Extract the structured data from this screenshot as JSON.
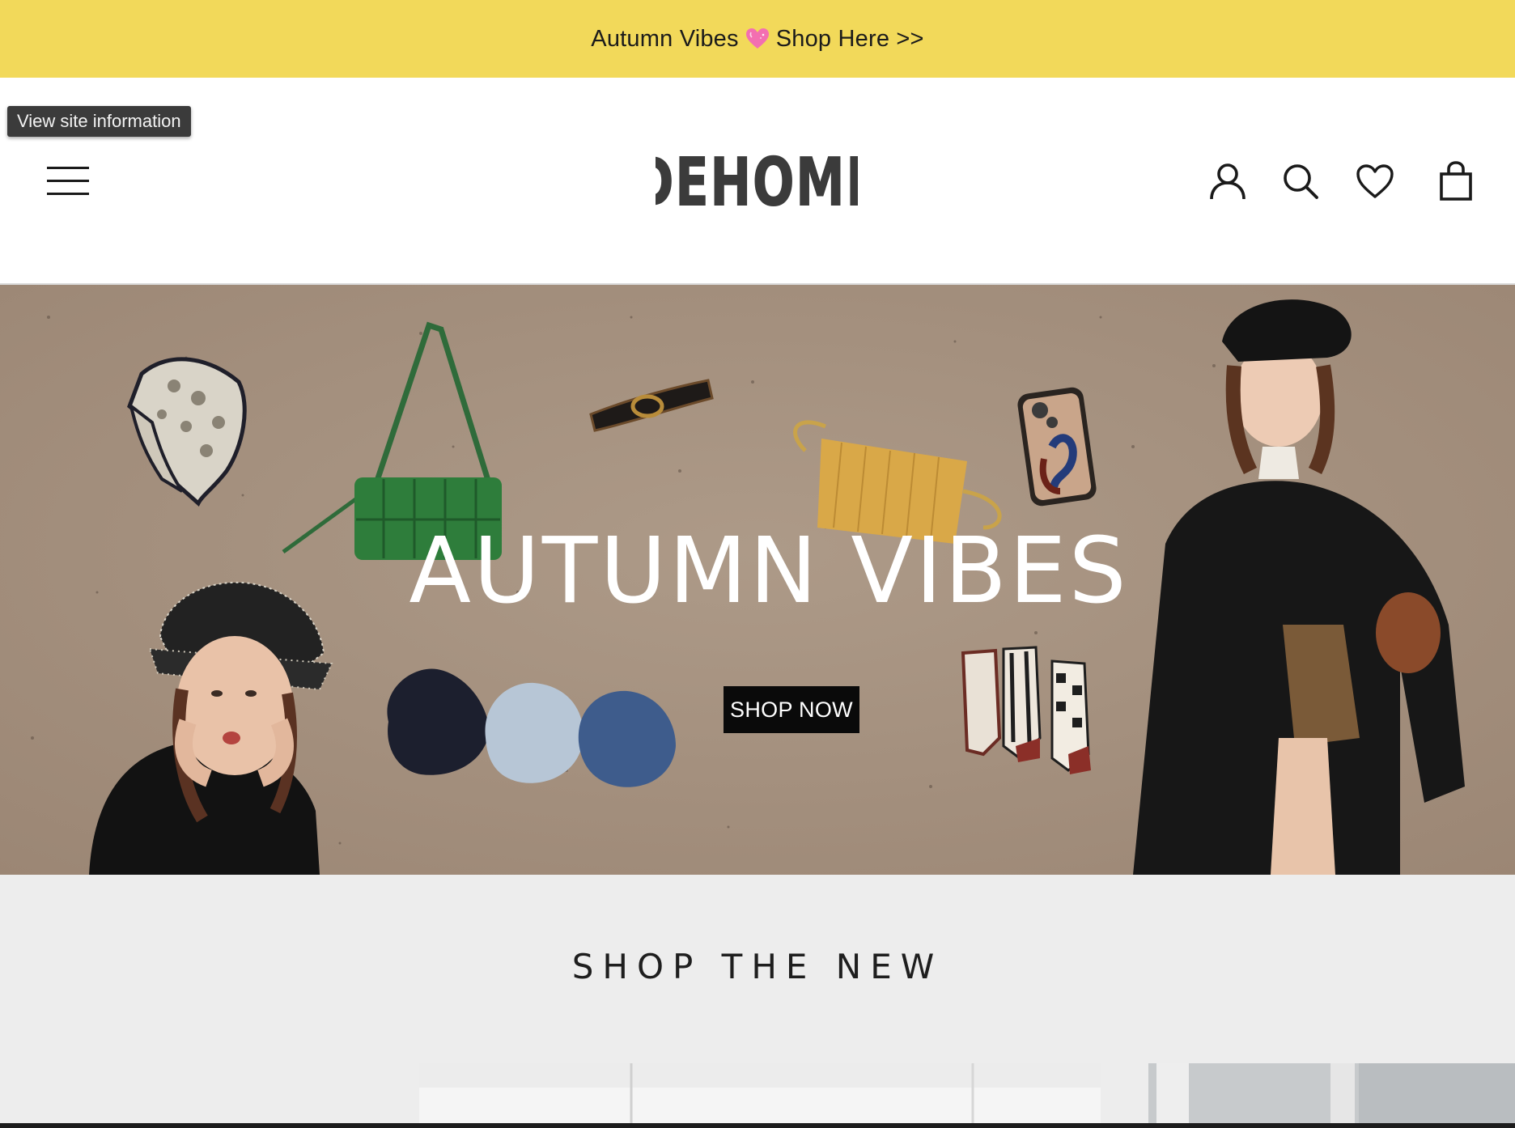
{
  "announcement": {
    "text_before": "Autumn Vibes",
    "text_after": "Shop Here >>",
    "icon": "pink-heart-emoji"
  },
  "browser": {
    "site_info_tooltip": "View site information"
  },
  "header": {
    "logo_text": "DEHOME",
    "icons": [
      "menu-icon",
      "account-icon",
      "search-icon",
      "wishlist-heart-icon",
      "shopping-bag-icon"
    ]
  },
  "hero": {
    "title": "AUTUMN VIBES",
    "cta_label": "SHOP NOW"
  },
  "section": {
    "title": "SHOP THE NEW"
  },
  "colors": {
    "announcement_bg": "#f2d95a",
    "hero_bg": "#a48f7d",
    "cta_bg": "#0a0a0a",
    "page_bg": "#ededed"
  }
}
